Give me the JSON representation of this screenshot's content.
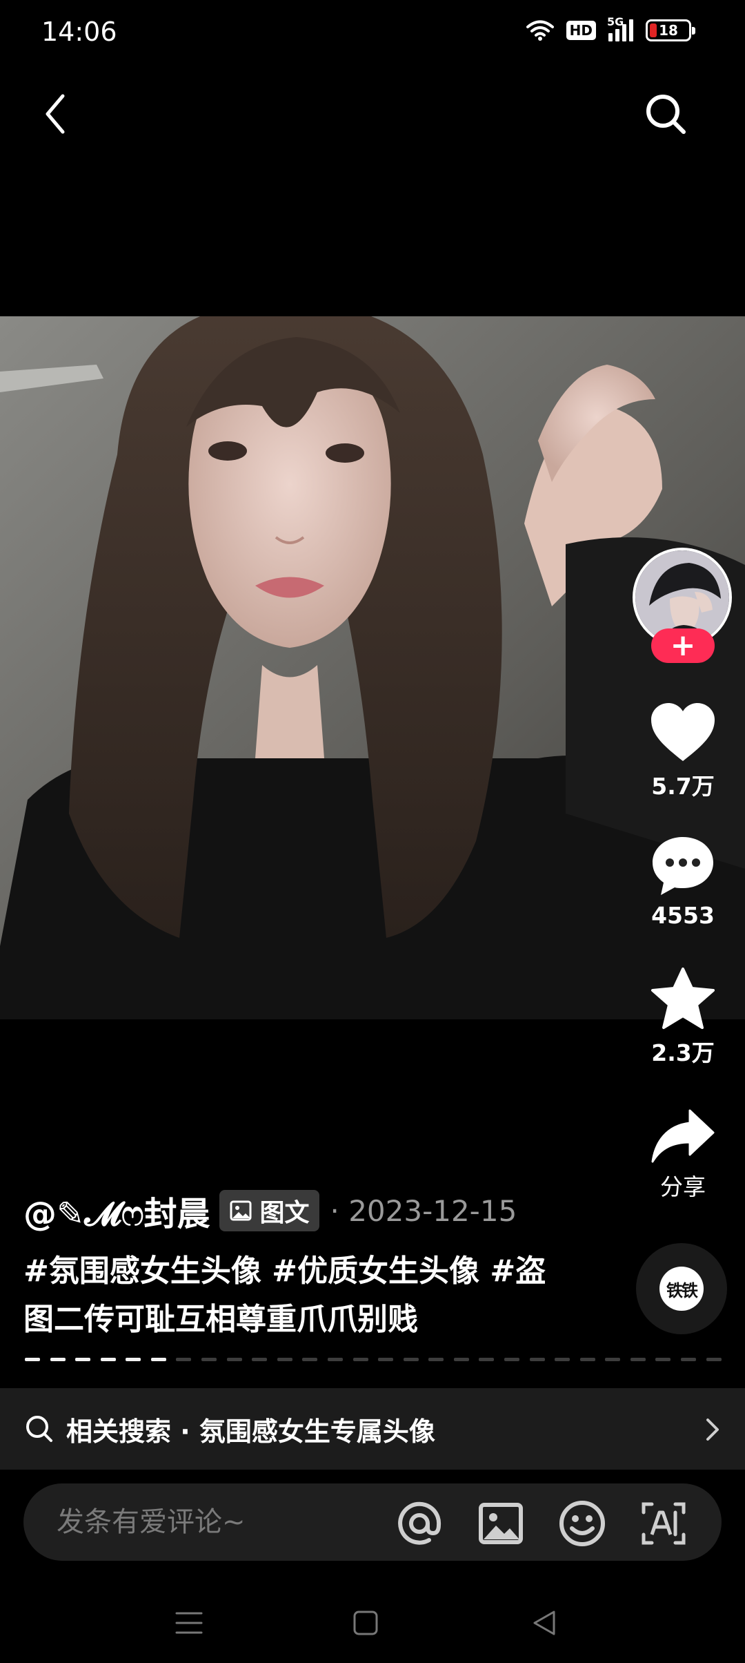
{
  "status_bar": {
    "time": "14:06",
    "hd_label": "HD",
    "network_label": "5G",
    "battery_level": "18",
    "icons": [
      "wifi-icon",
      "hd-icon",
      "signal-icon",
      "battery-icon"
    ]
  },
  "top_nav": {
    "back_icon": "chevron-left-icon",
    "search_icon": "search-icon"
  },
  "post": {
    "author": "@✎𝓜ෆ封晨",
    "type_label": "图文",
    "date": "· 2023-12-15",
    "description": "#氛围感女生头像 #优质女生头像 #盗图二传可耻互相尊重爪爪别贱",
    "image_count": 28,
    "current_image_index": 6
  },
  "actions": {
    "follow_label": "+",
    "like_count": "5.7万",
    "comment_count": "4553",
    "favorite_count": "2.3万",
    "share_label": "分享",
    "music_label": "铁铁"
  },
  "related_search": {
    "text": "相关搜索 · 氛围感女生专属头像"
  },
  "comment_bar": {
    "placeholder": "发条有爱评论~",
    "icons": [
      "at-icon",
      "image-icon",
      "emoji-icon",
      "ai-icon"
    ]
  },
  "colors": {
    "background": "#000000",
    "accent": "#fe2c55",
    "muted_text": "#9a9a9a",
    "battery_low": "#e02424"
  }
}
